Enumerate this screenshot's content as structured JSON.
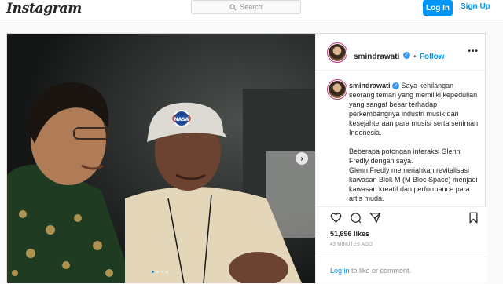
{
  "header": {
    "logo": "Instagram",
    "search_placeholder": "Search",
    "login_label": "Log In",
    "signup_label": "Sign Up"
  },
  "post": {
    "username": "smindrawati",
    "verified_mark": "✓",
    "follow_label": "Follow",
    "more_label": "•••",
    "caption": {
      "line1": "Saya kehilangan seorang teman yang memiliki kepedulian yang sangat besar terhadap perkembangnya industri musik dan kesejahteraan para musisi serta seniman Indonesia.",
      "para2": "Beberapa potongan interaksi Glenn Fredly dengan saya.",
      "para3": "Glenn Fredly memeriahkan revitalisasi kawasan Blok M (M Bloc Space) menjadi kawasan kreatif dan performance para artis muda."
    },
    "likes": "51,696 likes",
    "timestamp": "43 MINUTES AGO",
    "comment": {
      "login_link": "Log in",
      "rest": " to like or comment."
    },
    "carousel": {
      "next_glyph": "›",
      "slides": 4,
      "active_index": 0
    },
    "photo_cap_text": "NASA"
  },
  "icons": [
    "search-icon",
    "heart-icon",
    "comment-icon",
    "share-icon",
    "bookmark-icon",
    "chevron-right-icon"
  ],
  "colors": {
    "accent": "#0095f6",
    "verified": "#3897f0",
    "border": "#dbdbdb",
    "muted": "#8e8e8e"
  }
}
